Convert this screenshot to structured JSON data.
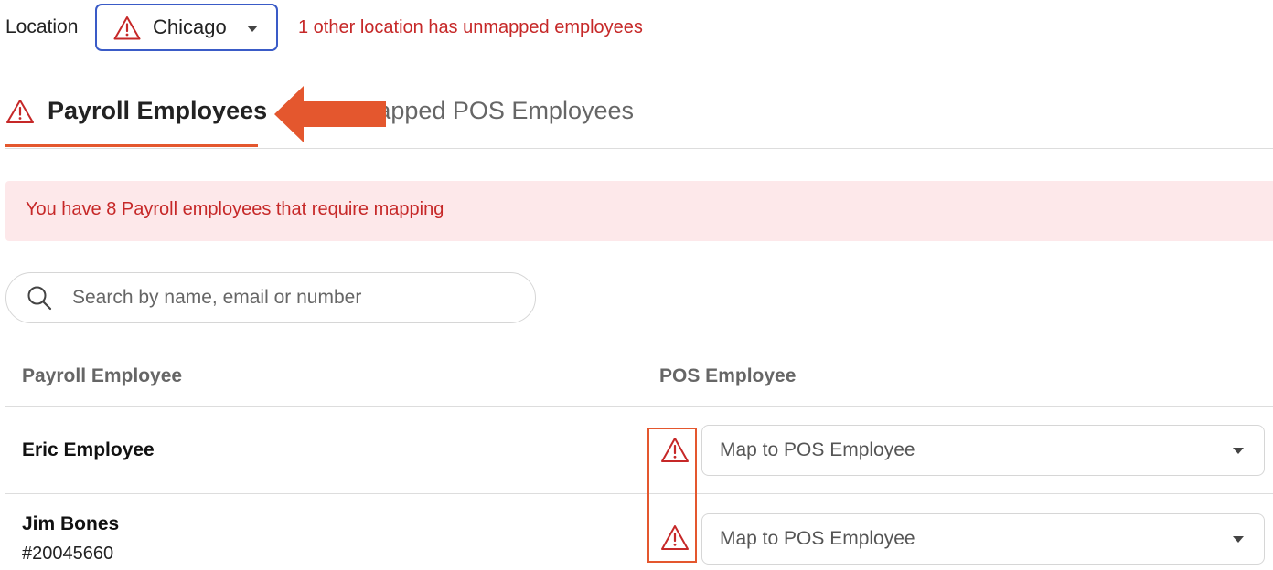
{
  "location": {
    "label": "Location",
    "selected": "Chicago",
    "warning_text": "1 other location has unmapped employees"
  },
  "tabs": [
    {
      "label": "Payroll Employees",
      "active": true,
      "icon": "warning-triangle-icon"
    },
    {
      "label": "Unmapped POS Employees",
      "active": false
    }
  ],
  "banner": {
    "text": "You have 8 Payroll employees that require mapping"
  },
  "search": {
    "placeholder": "Search by name, email or number",
    "value": ""
  },
  "table": {
    "headers": {
      "payroll": "Payroll Employee",
      "pos": "POS Employee"
    },
    "rows": [
      {
        "name": "Eric Employee",
        "number": "",
        "pos_placeholder": "Map to POS Employee",
        "warning": true
      },
      {
        "name": "Jim Bones",
        "number": "#20045660",
        "pos_placeholder": "Map to POS Employee",
        "warning": true
      }
    ]
  },
  "colors": {
    "warning_red": "#c62828",
    "accent_orange": "#e4572e",
    "banner_bg": "#fde8ea",
    "select_border_focus": "#3a5bc7"
  }
}
